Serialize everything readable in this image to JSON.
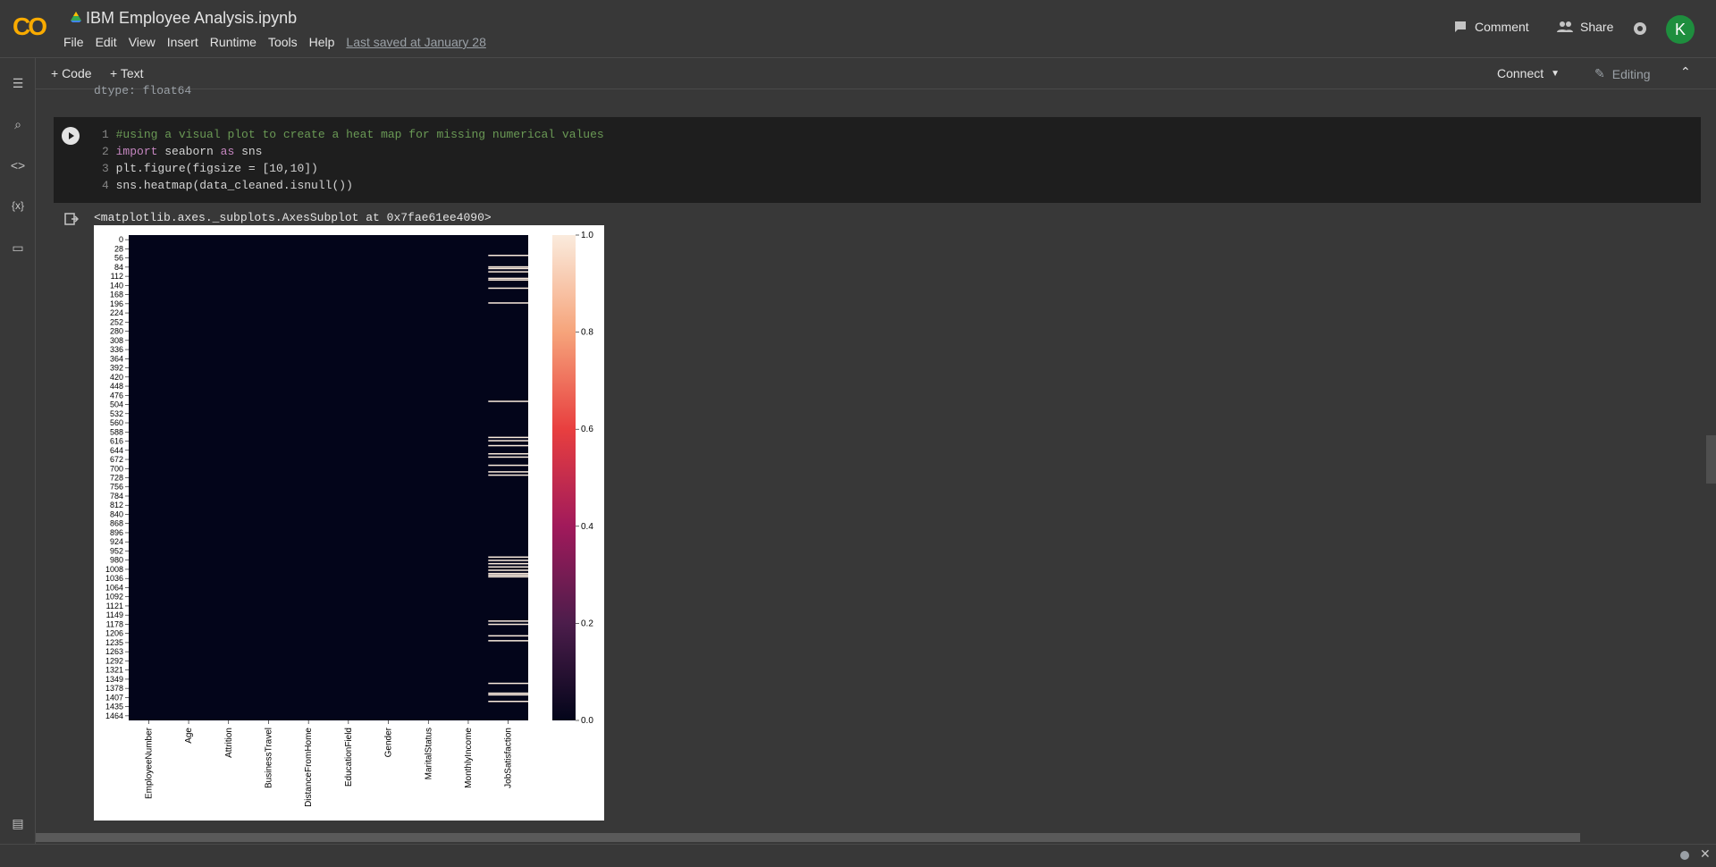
{
  "app": {
    "logo": "CO",
    "notebook_title": "IBM Employee Analysis.ipynb",
    "menu": [
      "File",
      "Edit",
      "View",
      "Insert",
      "Runtime",
      "Tools",
      "Help"
    ],
    "last_saved": "Last saved at January 28"
  },
  "header_right": {
    "comment_label": "Comment",
    "share_label": "Share",
    "avatar_letter": "K"
  },
  "toolbar": {
    "code_label": "+ Code",
    "text_label": "+ Text",
    "connect_label": "Connect",
    "editing_label": "Editing"
  },
  "prev_output": "dtype: float64",
  "cell": {
    "lines": [
      {
        "n": "1",
        "text": "#using a visual plot to create a heat map for missing numerical values"
      },
      {
        "n": "2",
        "kw": "import",
        "rest": " seaborn ",
        "kw2": "as",
        "rest2": " sns"
      },
      {
        "n": "3",
        "text": "plt.figure(figsize = [10,10])"
      },
      {
        "n": "4",
        "text": "sns.heatmap(data_cleaned.isnull())"
      }
    ]
  },
  "output_repr": "<matplotlib.axes._subplots.AxesSubplot at 0x7fae61ee4090>",
  "colors": {
    "heat_low": "#03051a",
    "heat_high": "#faebdd",
    "missing": "#faebdd"
  },
  "chart_data": {
    "type": "heatmap",
    "title": "",
    "columns": [
      "EmployeeNumber",
      "Age",
      "Attrition",
      "BusinessTravel",
      "DistanceFromHome",
      "EducationField",
      "Gender",
      "MaritalStatus",
      "MonthlyIncome",
      "JobSatisfaction"
    ],
    "row_ticks": [
      "0",
      "28",
      "56",
      "84",
      "112",
      "140",
      "168",
      "196",
      "224",
      "252",
      "280",
      "308",
      "336",
      "364",
      "392",
      "420",
      "448",
      "476",
      "504",
      "532",
      "560",
      "588",
      "616",
      "644",
      "672",
      "700",
      "728",
      "756",
      "784",
      "812",
      "840",
      "868",
      "896",
      "924",
      "952",
      "980",
      "1008",
      "1036",
      "1064",
      "1092",
      "1121",
      "1149",
      "1178",
      "1206",
      "1235",
      "1263",
      "1292",
      "1321",
      "1349",
      "1378",
      "1407",
      "1435",
      "1464"
    ],
    "row_range": [
      0,
      1480
    ],
    "missing_column": "JobSatisfaction",
    "missing_rows_approx": [
      60,
      95,
      100,
      110,
      130,
      135,
      160,
      205,
      505,
      615,
      625,
      640,
      665,
      675,
      700,
      720,
      730,
      980,
      990,
      1000,
      1010,
      1020,
      1030,
      1035,
      1040,
      1175,
      1185,
      1220,
      1235,
      1365,
      1395,
      1400,
      1420
    ],
    "colorbar": {
      "min": 0.0,
      "max": 1.0,
      "ticks": [
        "0.0",
        "0.2",
        "0.4",
        "0.6",
        "0.8",
        "1.0"
      ]
    }
  }
}
